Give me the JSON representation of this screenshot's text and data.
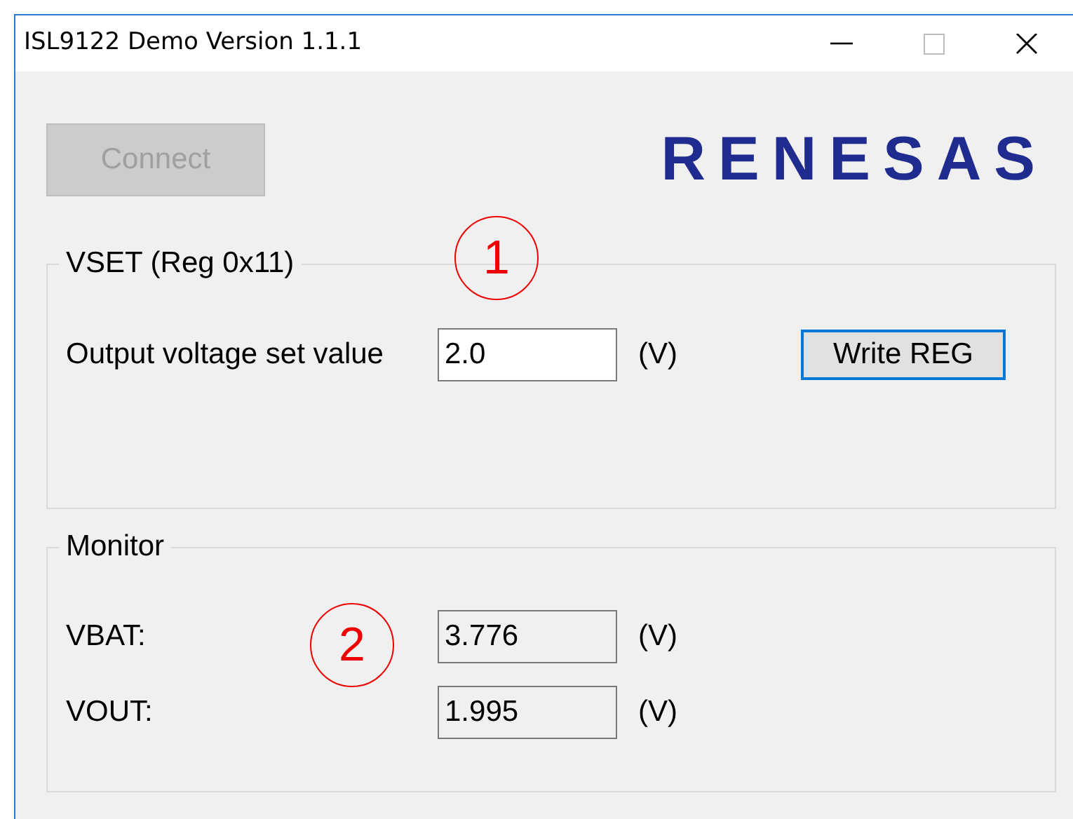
{
  "window": {
    "title": "ISL9122 Demo Version 1.1.1"
  },
  "connect_button": {
    "label": "Connect",
    "disabled": true
  },
  "logo": {
    "text": "RENESAS"
  },
  "vset_group": {
    "title": "VSET (Reg 0x11)",
    "label": "Output voltage set value",
    "value": "2.0",
    "unit": "(V)",
    "button": {
      "label": "Write REG",
      "focused": true
    }
  },
  "monitor_group": {
    "title": "Monitor",
    "rows": [
      {
        "label": "VBAT:",
        "value": "3.776",
        "unit": "(V)"
      },
      {
        "label": "VOUT:",
        "value": "1.995",
        "unit": "(V)"
      }
    ]
  },
  "annotations": [
    {
      "text": "1"
    },
    {
      "text": "2"
    }
  ]
}
